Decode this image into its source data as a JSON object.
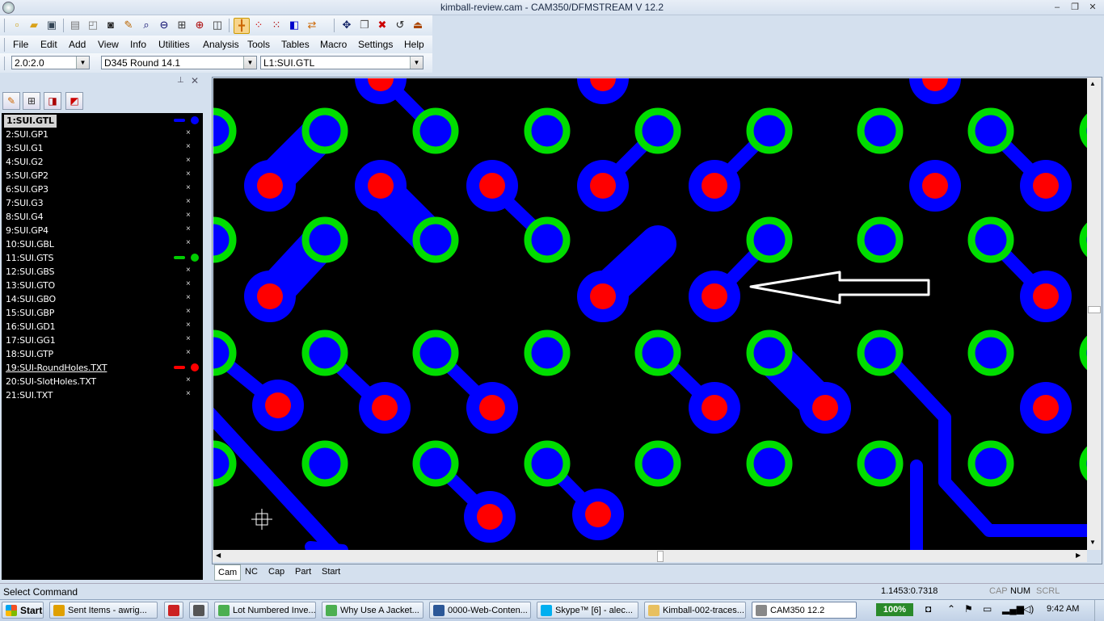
{
  "window": {
    "title": "kimball-review.cam - CAM350/DFMSTREAM V 12.2",
    "minimize": "–",
    "restore": "❐",
    "close": "✕"
  },
  "toolbar": {
    "icons": [
      "new-file-icon",
      "open-folder-icon",
      "save-icon",
      "print-icon",
      "print-preview-icon",
      "camera-icon",
      "redraw-icon",
      "zoom-window-icon",
      "zoom-out-icon",
      "zoom-all-icon",
      "zoom-in-icon",
      "zoom-previous-icon",
      "snap-icon",
      "grid-icon",
      "dots-icon",
      "layers-color-icon",
      "toggle-icon",
      "move-icon",
      "copy-icon",
      "delete-icon",
      "undo-icon",
      "mirror-icon"
    ]
  },
  "menu": [
    "File",
    "Edit",
    "Add",
    "View",
    "Info",
    "Utilities",
    "Analysis",
    "Tools",
    "Tables",
    "Macro",
    "Settings",
    "Help"
  ],
  "combos": {
    "grid": "2.0:2.0",
    "dcode": "D345  Round 14.1",
    "layer": "L1:SUI.GTL"
  },
  "panel": {
    "pin": "📌",
    "close": "✕"
  },
  "layers": [
    {
      "label": "1:SUI.GTL",
      "color": "#0000ff",
      "selected": true
    },
    {
      "label": "2:SUI.GP1",
      "mark": "×"
    },
    {
      "label": "3:SUI.G1",
      "mark": "×"
    },
    {
      "label": "4:SUI.G2",
      "mark": "×"
    },
    {
      "label": "5:SUI.GP2",
      "mark": "×"
    },
    {
      "label": "6:SUI.GP3",
      "mark": "×"
    },
    {
      "label": "7:SUI.G3",
      "mark": "×"
    },
    {
      "label": "8:SUI.G4",
      "mark": "×"
    },
    {
      "label": "9:SUI.GP4",
      "mark": "×"
    },
    {
      "label": "10:SUI.GBL",
      "mark": "×"
    },
    {
      "label": "11:SUI.GTS",
      "color": "#00cc00"
    },
    {
      "label": "12:SUI.GBS",
      "mark": "×"
    },
    {
      "label": "13:SUI.GTO",
      "mark": "×"
    },
    {
      "label": "14:SUI.GBO",
      "mark": "×"
    },
    {
      "label": "15:SUI.GBP",
      "mark": "×"
    },
    {
      "label": "16:SUI.GD1",
      "mark": "×"
    },
    {
      "label": "17:SUI.GG1",
      "mark": "×"
    },
    {
      "label": "18:SUI.GTP",
      "mark": "×"
    },
    {
      "label": "19:SUI-RoundHoles.TXT",
      "color": "#ff0000",
      "underline": true
    },
    {
      "label": "20:SUI-SlotHoles.TXT",
      "mark": "×"
    },
    {
      "label": "21:SUI.TXT",
      "mark": "×"
    }
  ],
  "tabs": [
    "Cam",
    "NC",
    "Cap",
    "Part",
    "Start"
  ],
  "status": {
    "command": "Select Command",
    "coords": "1.1453:0.7318",
    "caps": "CAP",
    "num": "NUM",
    "scrl": "SCRL"
  },
  "taskbar": {
    "start": "Start",
    "items": [
      {
        "label": "Sent Items - awrig...",
        "icon_color": "#e0a000"
      },
      {
        "label": "",
        "icon_color": "#cc2222"
      },
      {
        "label": "",
        "icon_color": "#555555"
      },
      {
        "label": "Lot Numbered Inve...",
        "icon_color": "#4caf50"
      },
      {
        "label": "Why Use A Jacket...",
        "icon_color": "#4caf50"
      },
      {
        "label": "0000-Web-Conten...",
        "icon_color": "#2b5797"
      },
      {
        "label": "Skype™ [6] - alec...",
        "icon_color": "#00aff0"
      },
      {
        "label": "Kimball-002-traces...",
        "icon_color": "#e8c060"
      },
      {
        "label": "CAM350 12.2",
        "icon_color": "#888888",
        "active": true
      }
    ],
    "battery": "100%",
    "clock": "9:42 AM"
  },
  "colors": {
    "board": "#000000",
    "copper": "#0000ff",
    "mask": "#00dd00",
    "drill": "#ff0000",
    "arrow": "#ffffff"
  }
}
